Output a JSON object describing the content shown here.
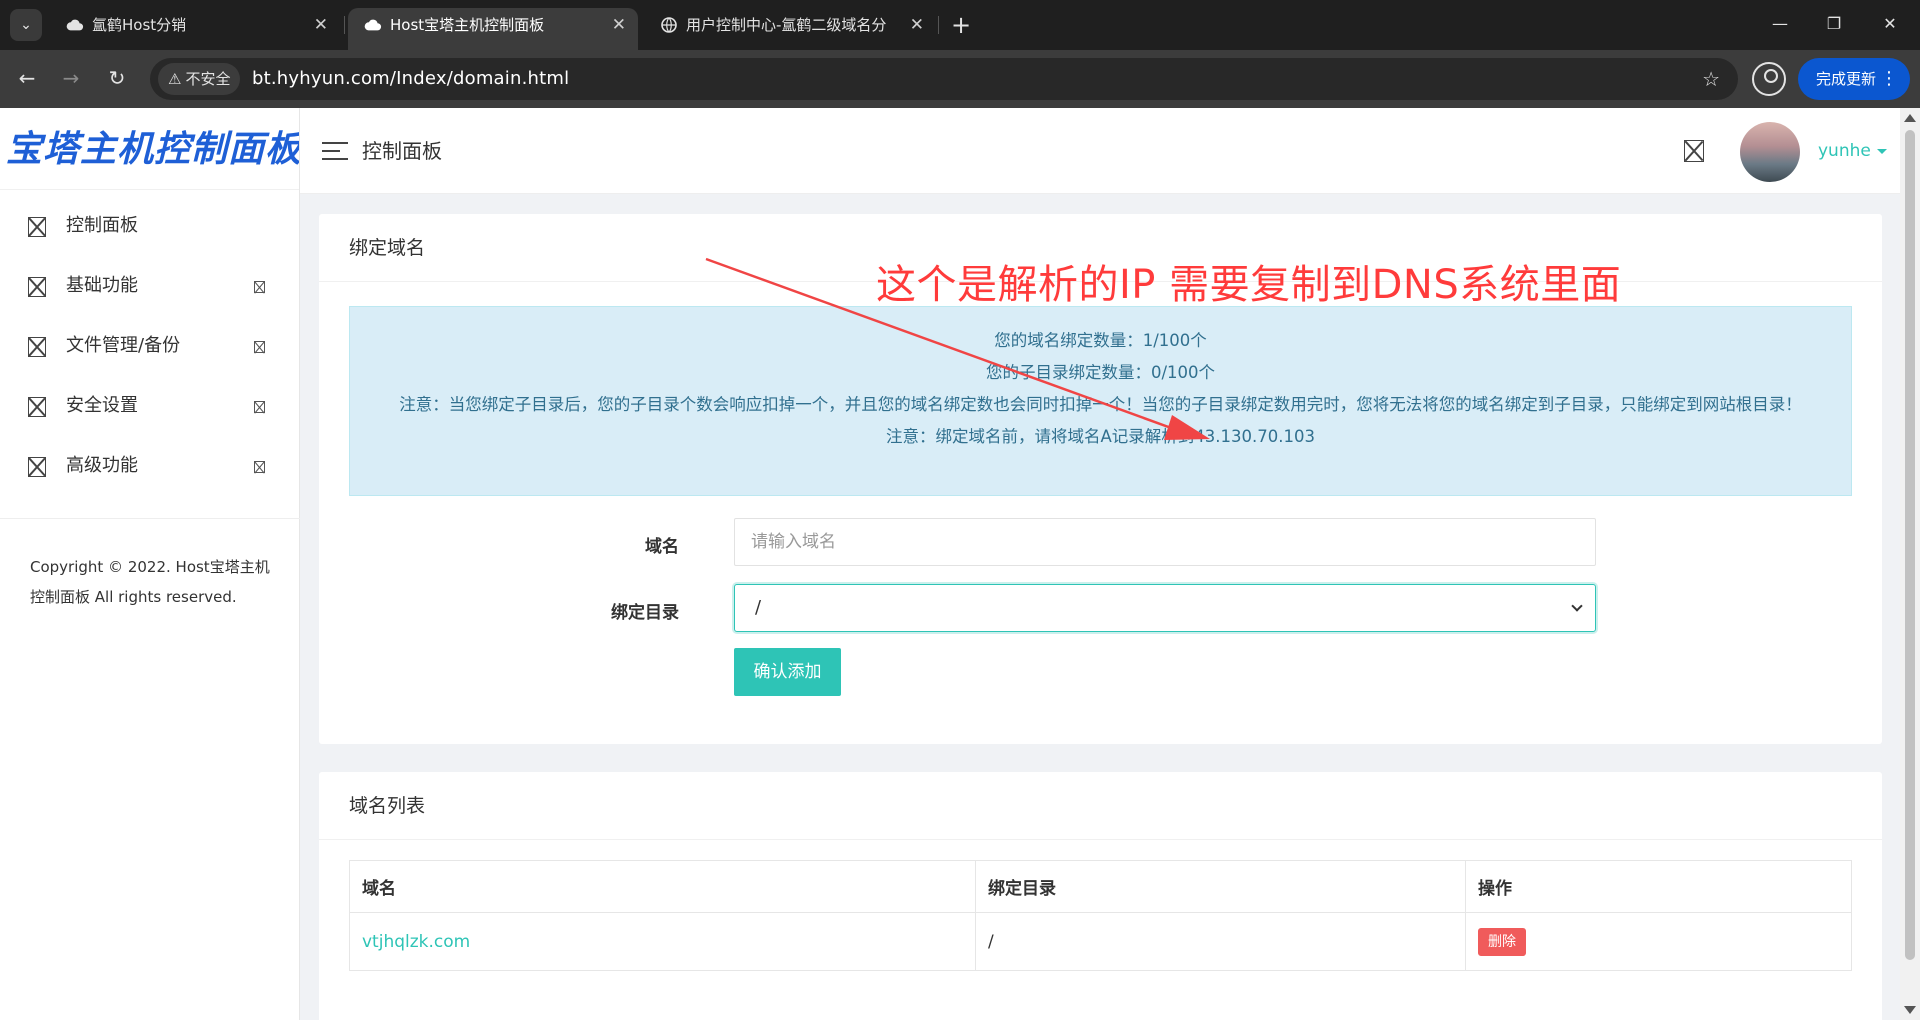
{
  "browser": {
    "tabs": [
      {
        "title": "氲鹤Host分销",
        "active": false
      },
      {
        "title": "Host宝塔主机控制面板",
        "active": true
      },
      {
        "title": "用户控制中心-氲鹤二级域名分发",
        "active": false
      }
    ],
    "security_label": "不安全",
    "url": "bt.hyhyun.com/Index/domain.html",
    "update_button": "完成更新"
  },
  "sidebar": {
    "brand": "宝塔主机控制面板",
    "items": [
      {
        "label": "控制面板",
        "expandable": false
      },
      {
        "label": "基础功能",
        "expandable": true
      },
      {
        "label": "文件管理/备份",
        "expandable": true
      },
      {
        "label": "安全设置",
        "expandable": true
      },
      {
        "label": "高级功能",
        "expandable": true
      }
    ],
    "copyright": "Copyright © 2022. Host宝塔主机控制面板 All rights reserved."
  },
  "topbar": {
    "title": "控制面板",
    "username": "yunhe"
  },
  "bind_card": {
    "title": "绑定域名",
    "alert": {
      "line1": "您的域名绑定数量：1/100个",
      "line2": "您的子目录绑定数量：0/100个",
      "line3": "注意：当您绑定子目录后，您的子目录个数会响应扣掉一个，并且您的域名绑定数也会同时扣掉一个！当您的子目录绑定数用完时，您将无法将您的域名绑定到子目录，只能绑定到网站根目录！",
      "line4": "注意：绑定域名前，请将域名A记录解析到43.130.70.103"
    },
    "domain_label": "域名",
    "domain_placeholder": "请输入域名",
    "domain_value": "",
    "dir_label": "绑定目录",
    "dir_value": "/",
    "submit_label": "确认添加"
  },
  "list_card": {
    "title": "域名列表",
    "columns": [
      "域名",
      "绑定目录",
      "操作"
    ],
    "rows": [
      {
        "domain": "vtjhqlzk.com",
        "dir": "/",
        "action": "删除"
      }
    ]
  },
  "annotation": {
    "text": "这个是解析的IP 需要复制到DNS系统里面",
    "color": "#ff3b3b"
  },
  "colors": {
    "accent": "#2ec4b6",
    "brand": "#1e5fd6",
    "danger": "#f05b5b",
    "alert_bg": "#d9edf7"
  }
}
